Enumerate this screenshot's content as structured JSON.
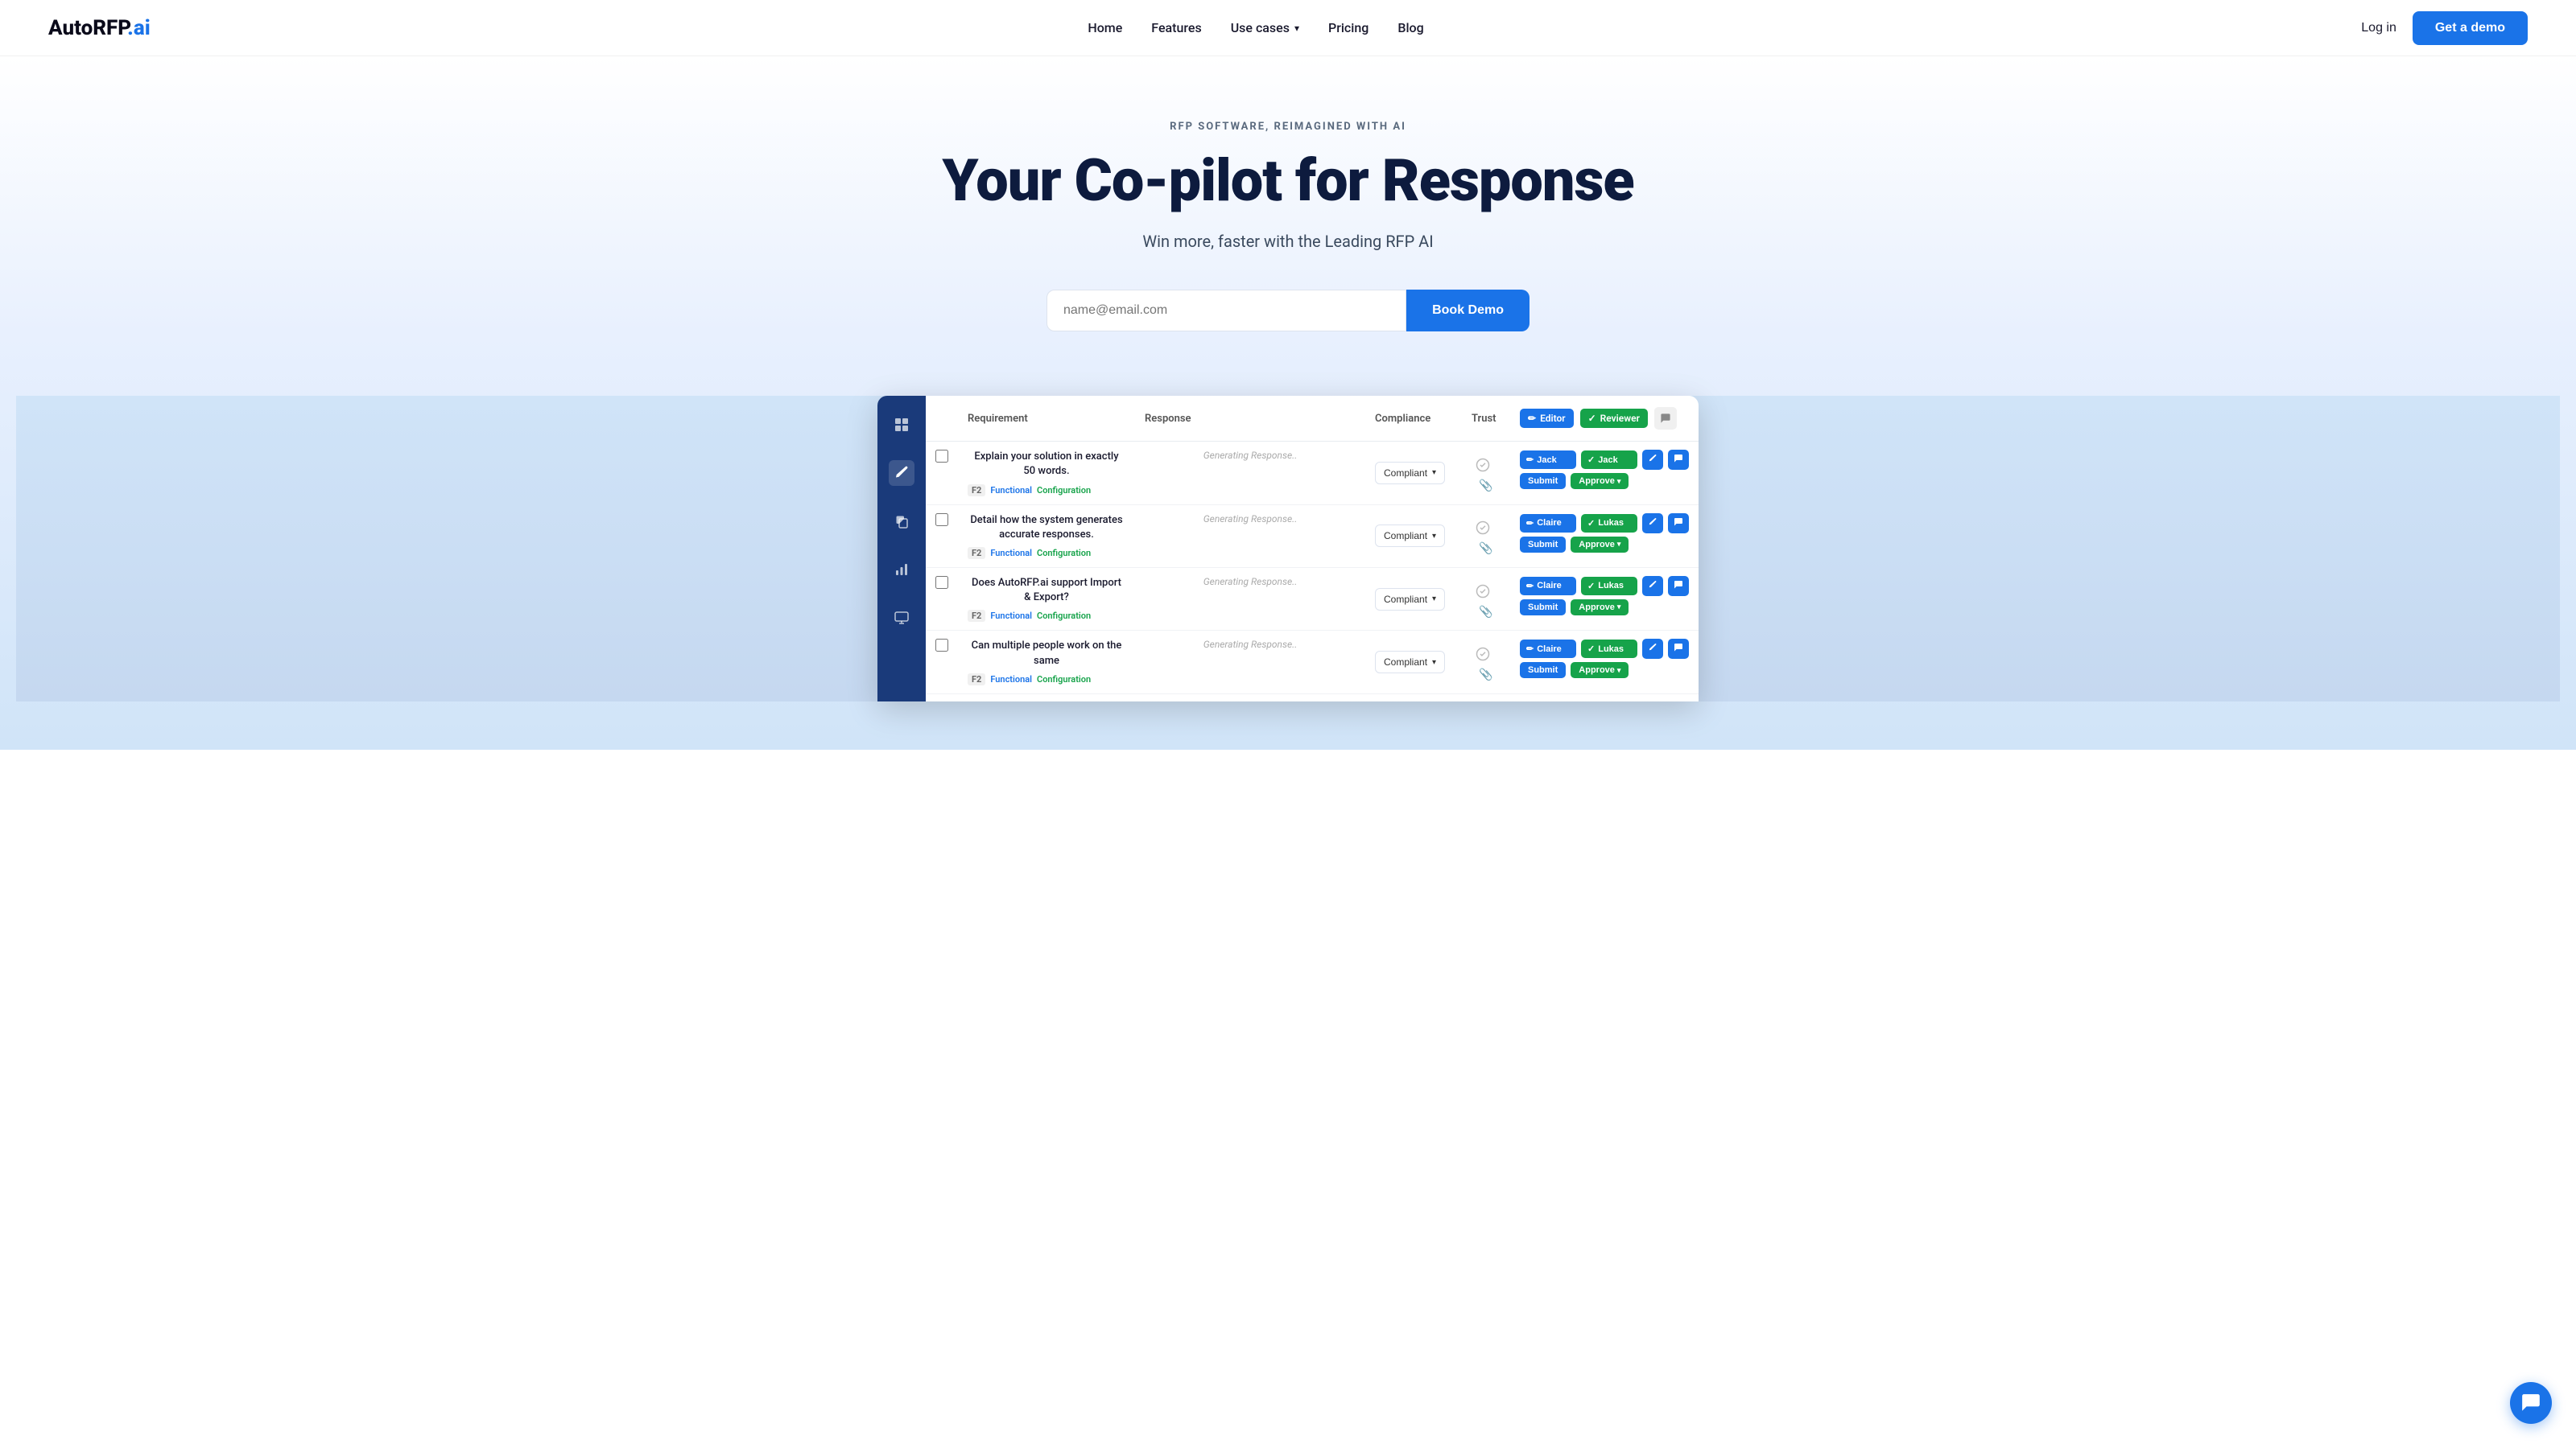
{
  "nav": {
    "logo_text": "AutoRFP",
    "logo_accent": ".ai",
    "links": [
      {
        "label": "Home",
        "id": "home"
      },
      {
        "label": "Features",
        "id": "features"
      },
      {
        "label": "Use cases",
        "id": "use-cases",
        "has_dropdown": true
      },
      {
        "label": "Pricing",
        "id": "pricing"
      },
      {
        "label": "Blog",
        "id": "blog"
      }
    ],
    "login_label": "Log in",
    "demo_label": "Get a demo"
  },
  "hero": {
    "tag": "RFP SOFTWARE, REIMAGINED WITH AI",
    "title": "Your Co-pilot for Response",
    "subtitle": "Win more, faster with the Leading RFP AI",
    "email_placeholder": "name@email.com",
    "book_demo_label": "Book Demo"
  },
  "sidebar": {
    "icons": [
      {
        "id": "grid-icon",
        "symbol": "⊞",
        "active": false
      },
      {
        "id": "edit-icon",
        "symbol": "✏",
        "active": true
      },
      {
        "id": "copy-icon",
        "symbol": "⧉",
        "active": false
      },
      {
        "id": "chart-icon",
        "symbol": "📊",
        "active": false
      },
      {
        "id": "monitor-icon",
        "symbol": "▭",
        "active": false
      }
    ]
  },
  "table": {
    "headers": {
      "requirement": "Requirement",
      "response": "Response",
      "compliance": "Compliance",
      "trust": "Trust",
      "editor_label": "Editor",
      "reviewer_label": "Reviewer"
    },
    "rows": [
      {
        "id": "row-1",
        "requirement": "Explain your solution in exactly 50 words.",
        "tag_f": "F2",
        "tag_functional": "Functional",
        "tag_config": "Configuration",
        "response_placeholder": "Generating Response..",
        "compliance": "Compliant",
        "editor_name": "Jack",
        "reviewer_name": "Jack",
        "submit_label": "Submit",
        "approve_label": "Approve"
      },
      {
        "id": "row-2",
        "requirement": "Detail how the system generates accurate responses.",
        "tag_f": "F2",
        "tag_functional": "Functional",
        "tag_config": "Configuration",
        "response_placeholder": "Generating Response..",
        "compliance": "Compliant",
        "editor_name": "Claire",
        "reviewer_name": "Lukas",
        "submit_label": "Submit",
        "approve_label": "Approve"
      },
      {
        "id": "row-3",
        "requirement": "Does AutoRFP.ai support Import & Export?",
        "tag_f": "F2",
        "tag_functional": "Functional",
        "tag_config": "Configuration",
        "response_placeholder": "Generating Response..",
        "compliance": "Compliant",
        "editor_name": "Claire",
        "reviewer_name": "Lukas",
        "submit_label": "Submit",
        "approve_label": "Approve"
      },
      {
        "id": "row-4",
        "requirement": "Can multiple people work on the same",
        "tag_f": "F2",
        "tag_functional": "Functional",
        "tag_config": "Configuration",
        "response_placeholder": "Generating Response..",
        "compliance": "Compliant",
        "editor_name": "Claire",
        "reviewer_name": "Lukas",
        "submit_label": "Submit",
        "approve_label": "Approve"
      }
    ]
  },
  "chat_bubble": {
    "symbol": "💬"
  }
}
